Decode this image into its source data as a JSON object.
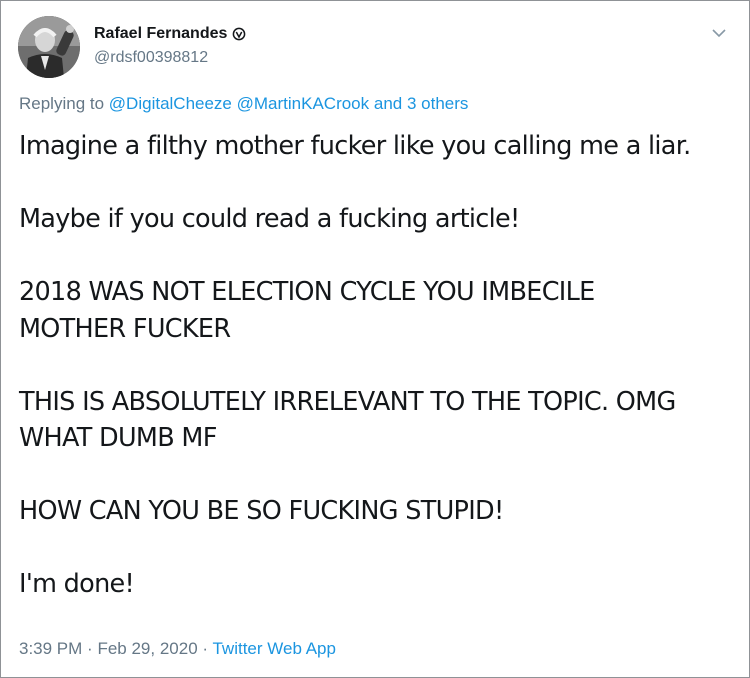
{
  "author": {
    "name": "Rafael Fernandes",
    "handle": "@rdsf00398812",
    "badge_icon": "fingerprint-badge-icon"
  },
  "reply_context": {
    "prefix": "Replying to",
    "mention_1": "@DigitalCheeze",
    "mention_2": "@MartinKACrook",
    "others": "and 3 others"
  },
  "tweet": {
    "paragraphs": [
      "Imagine a filthy mother fucker like you calling me a liar.",
      "Maybe if you could read a fucking article!",
      "2018 WAS NOT ELECTION CYCLE YOU IMBECILE\nMOTHER FUCKER",
      "THIS IS ABSOLUTELY IRRELEVANT TO THE TOPIC. OMG\nWHAT DUMB MF",
      "HOW CAN YOU BE SO FUCKING STUPID!",
      "I'm done!"
    ]
  },
  "meta": {
    "time": "3:39 PM",
    "separator": "·",
    "date": "Feb 29, 2020",
    "app": "Twitter Web App"
  },
  "colors": {
    "link": "#1b95e0",
    "secondary_text": "#657786",
    "primary_text": "#14171a"
  }
}
